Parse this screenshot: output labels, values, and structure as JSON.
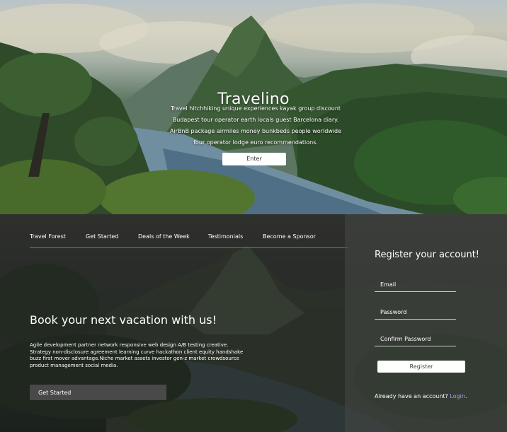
{
  "hero": {
    "title": "Travelino",
    "description": "Travel hitchhiking unique experiences kayak group discount Budapest tour operator earth locals guest Barcelona diary. AirBnB package airmiles money bunkbeds people worldwide four operator lodge euro recommendations.",
    "enter_label": "Enter"
  },
  "nav": {
    "items": [
      {
        "label": "Travel Forest"
      },
      {
        "label": "Get Started"
      },
      {
        "label": "Deals of the Week"
      },
      {
        "label": "Testimonials"
      },
      {
        "label": "Become a Sponsor"
      }
    ]
  },
  "main": {
    "heading": "Book your next vacation with us!",
    "text": "Agile development partner network responsive web design A/B testing creative. Strategy non-disclosure agreement learning curve hackathon client equity handshake buzz first mover advantage.Niche market assets investor gen-z market crowdsource product management social media.",
    "get_started_label": "Get Started"
  },
  "register": {
    "title": "Register your account!",
    "email_placeholder": "Email",
    "password_placeholder": "Password",
    "confirm_placeholder": "Confirm Password",
    "register_label": "Register",
    "login_prompt": "Already have an account?",
    "login_link": "Login",
    "login_suffix": "."
  },
  "colors": {
    "link": "#9aa6ff",
    "panel": "#464846"
  }
}
